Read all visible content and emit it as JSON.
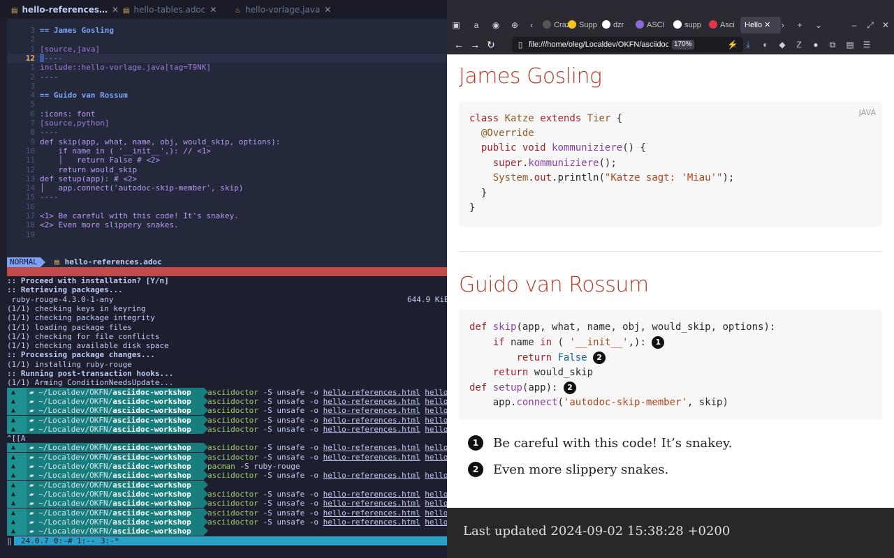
{
  "editor": {
    "tabs": [
      {
        "label": "hello-references…",
        "active": true
      },
      {
        "label": "hello-tables.adoc",
        "active": false
      },
      {
        "label": "hello-vorlage.java",
        "active": false
      }
    ],
    "lines": [
      {
        "num": "3",
        "text": "== James Gosling"
      },
      {
        "num": "2",
        "text": ""
      },
      {
        "num": "1",
        "text": "[source,java]"
      },
      {
        "num": "12",
        "text": "----"
      },
      {
        "num": "1",
        "text": "include::hello-vorlage.java[tag=T9NK]"
      },
      {
        "num": "2",
        "text": "----"
      },
      {
        "num": "3",
        "text": ""
      },
      {
        "num": "4",
        "text": "== Guido van Rossum"
      },
      {
        "num": "5",
        "text": ""
      },
      {
        "num": "6",
        "text": ":icons: font"
      },
      {
        "num": "7",
        "text": "[source,python]"
      },
      {
        "num": "8",
        "text": "----"
      },
      {
        "num": "9",
        "text": "def skip(app, what, name, obj, would_skip, options):"
      },
      {
        "num": "10",
        "text": "    if name in ( '__init__',): // <1>"
      },
      {
        "num": "11",
        "text": "    │   return False # <2>"
      },
      {
        "num": "12",
        "text": "    return would_skip"
      },
      {
        "num": "13",
        "text": "def setup(app): # <2>"
      },
      {
        "num": "14",
        "text": "│   app.connect('autodoc-skip-member', skip)"
      },
      {
        "num": "15",
        "text": "----"
      },
      {
        "num": "16",
        "text": ""
      },
      {
        "num": "17",
        "text": "<1> Be careful with this code! It's snakey."
      },
      {
        "num": "18",
        "text": "<2> Even more slippery snakes."
      },
      {
        "num": "19",
        "text": ""
      }
    ],
    "mode": "NORMAL",
    "status_file": "hello-references.adoc"
  },
  "terminal": {
    "lines": [
      {
        "text": ":: Proceed with installation? [Y/n]",
        "bold": true
      },
      {
        "text": ":: Retrieving packages...",
        "bold": true
      },
      {
        "text": " ruby-rouge-4.3.0-1-any",
        "size": "644.9 KiB"
      },
      {
        "text": "(1/1) checking keys in keyring"
      },
      {
        "text": "(1/1) checking package integrity"
      },
      {
        "text": "(1/1) loading package files"
      },
      {
        "text": "(1/1) checking for file conflicts"
      },
      {
        "text": "(1/1) checking available disk space"
      },
      {
        "text": ":: Processing package changes...",
        "bold": true
      },
      {
        "text": "(1/1) installing ruby-rouge"
      },
      {
        "text": ":: Running post-transaction hooks...",
        "bold": true
      },
      {
        "text": "(1/1) Arming ConditionNeedsUpdate..."
      }
    ],
    "prompt_path": "~/Localdev/OKFN/",
    "prompt_dir": "asciidoc-workshop",
    "prompts_a": [
      {
        "cmd": "asciidoctor",
        "args": " -S unsafe -o ",
        "file": "hello-references.html",
        "tail": "hello"
      },
      {
        "cmd": "asciidoctor",
        "args": " -S unsafe -o ",
        "file": "hello-references.html",
        "tail": "hello"
      },
      {
        "cmd": "asciidoctor",
        "args": " -S unsafe -o ",
        "file": "hello-references.html",
        "tail": "hello"
      },
      {
        "cmd": "asciidoctor",
        "args": " -S unsafe -o ",
        "file": "hello-references.html",
        "tail": "hello"
      },
      {
        "cmd": "asciidoctor",
        "args": " -S unsafe -o ",
        "file": "hello-references.html",
        "tail": "hello"
      }
    ],
    "ctrl_line": "^[[A",
    "prompts_b": [
      {
        "cmd": "asciidoctor",
        "args": " -S unsafe -o ",
        "file": "hello-references.html",
        "tail": "hello"
      },
      {
        "cmd": "asciidoctor",
        "args": " -S unsafe -o ",
        "file": "hello-references.html",
        "tail": "hello"
      },
      {
        "cmd": "pacman",
        "args": " -S ruby-rouge",
        "file": "",
        "tail": ""
      },
      {
        "cmd": "asciidoctor",
        "args": " -S unsafe -o ",
        "file": "hello-references.html",
        "tail": "hello"
      },
      {
        "cmd": "",
        "args": "",
        "file": "",
        "tail": ""
      },
      {
        "cmd": "asciidoctor",
        "args": " -S unsafe -o ",
        "file": "hello-references.html",
        "tail": "hello"
      },
      {
        "cmd": "asciidoctor",
        "args": " -S unsafe -o ",
        "file": "hello-references.html",
        "tail": "hello"
      },
      {
        "cmd": "asciidoctor",
        "args": " -S unsafe -o ",
        "file": "hello-references.html",
        "tail": "hello"
      },
      {
        "cmd": "asciidoctor",
        "args": " -S unsafe -o ",
        "file": "hello-references.html",
        "tail": "hello"
      },
      {
        "cmd": "",
        "args": "",
        "file": "",
        "tail": ""
      }
    ],
    "tmux": {
      "left": "‖",
      "version": "24.0.7",
      "win0": "0:-#",
      "win1": "1:--",
      "win3": "3:-*"
    }
  },
  "browser": {
    "tabs": [
      {
        "label": "Craz",
        "color": "#555555"
      },
      {
        "label": "Supp",
        "color": "#f5c518"
      },
      {
        "label": "dzr",
        "color": "#ffffff"
      },
      {
        "label": "ASCI",
        "color": "#8e6bd8"
      },
      {
        "label": "supp",
        "color": "#ffffff"
      },
      {
        "label": "Asci",
        "color": "#e0364a"
      }
    ],
    "active_tab": "Hello",
    "url": "file:///home/oleg/Localdev/OKFN/asciidoc",
    "zoom": "170%"
  },
  "doc": {
    "section1_title": "James Gosling",
    "java_lang": "JAVA",
    "section2_title": "Guido van Rossum",
    "callouts": [
      {
        "num": "1",
        "text": "Be careful with this code! It’s snakey."
      },
      {
        "num": "2",
        "text": "Even more slippery snakes."
      }
    ],
    "footer": "Last updated 2024-09-02 15:38:28 +0200"
  }
}
